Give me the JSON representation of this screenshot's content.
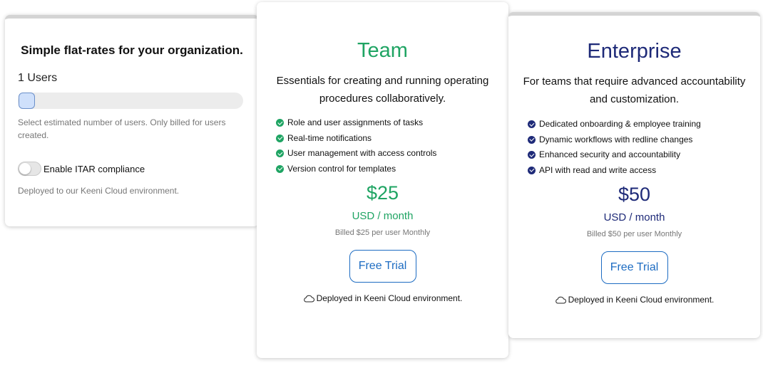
{
  "colors": {
    "team_accent": "#1fa463",
    "enterprise_accent": "#1e2a78",
    "button_blue": "#1d6cc2",
    "muted_text": "#777777"
  },
  "config": {
    "title": "Simple flat-rates for your organization.",
    "users_count": "1 Users",
    "slider_value": 1,
    "slider_hint": "Select estimated number of users. Only billed for users created.",
    "itar_label": "Enable ITAR compliance",
    "itar_enabled": false,
    "itar_desc": "Deployed to our Keeni Cloud environment."
  },
  "team": {
    "name": "Team",
    "description": "Essentials for creating and running operating procedures collaboratively.",
    "features": [
      "Role and user assignments of tasks",
      "Real-time notifications",
      "User management with access controls",
      "Version control for templates"
    ],
    "price": "$25",
    "period": "USD / month",
    "billed": "Billed $25 per user Monthly",
    "button": "Free Trial",
    "deployed": "Deployed in Keeni Cloud environment."
  },
  "enterprise": {
    "name": "Enterprise",
    "description": "For teams that require advanced accountability and customization.",
    "features": [
      "Dedicated onboarding & employee training",
      "Dynamic workflows with redline changes",
      "Enhanced security and accountability",
      "API with read and write access"
    ],
    "price": "$50",
    "period": "USD / month",
    "billed": "Billed $50 per user Monthly",
    "button": "Free Trial",
    "deployed": "Deployed in Keeni Cloud environment."
  }
}
